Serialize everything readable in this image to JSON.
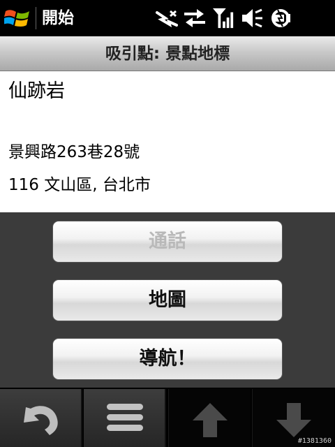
{
  "status_bar": {
    "start_label": "開始",
    "icons": [
      "windows-start-icon",
      "data-sync-icon",
      "signal-strength-icon",
      "volume-icon",
      "battery-icon"
    ]
  },
  "title_bar": {
    "title": "吸引點: 景點地標"
  },
  "details": {
    "name": "仙跡岩",
    "address_line1": "景興路263巷28號",
    "address_line2": "116 文山區, 台北市"
  },
  "actions": {
    "call_label": "通話",
    "call_enabled": false,
    "map_label": "地圖",
    "navigate_label": "導航！"
  },
  "softkeys": {
    "icons": [
      "back-icon",
      "menu-icon",
      "up-arrow-icon",
      "down-arrow-icon"
    ]
  },
  "watermark": "#1381360",
  "colors": {
    "status_bg": "#000000",
    "action_area_bg": "#3b3b3b",
    "disabled_text": "#b9b9b9"
  }
}
